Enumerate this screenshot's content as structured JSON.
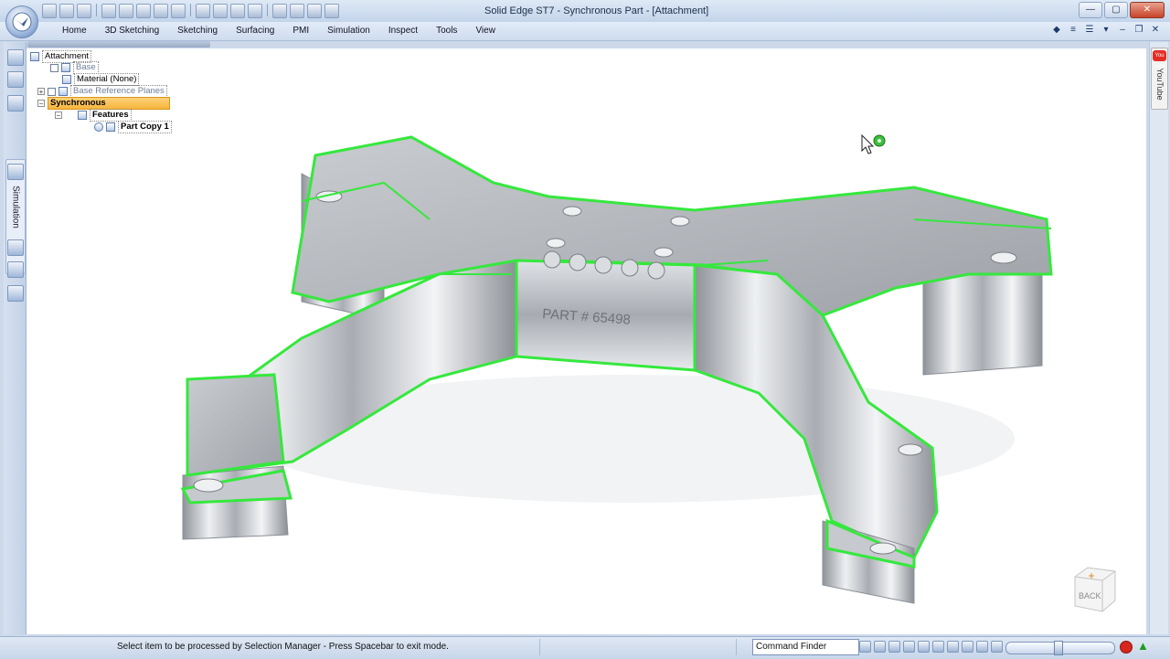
{
  "window": {
    "title": "Solid Edge ST7 - Synchronous Part - [Attachment]",
    "controls": {
      "minimize": "—",
      "maximize": "▢",
      "close": "✕"
    }
  },
  "ribbon": {
    "tabs": [
      "Home",
      "3D Sketching",
      "Sketching",
      "Surfacing",
      "PMI",
      "Simulation",
      "Inspect",
      "Tools",
      "View"
    ]
  },
  "left_bar": {
    "tab_label": "Simulation"
  },
  "right_bar": {
    "youtube_label": "YouTube",
    "youtube_logo": "You Tube"
  },
  "pathfinder": {
    "root": "Attachment",
    "items": [
      {
        "label": "Base"
      },
      {
        "label": "Material (None)"
      },
      {
        "label": "Base Reference Planes",
        "expander": "+"
      },
      {
        "label": "Synchronous",
        "expander": "−"
      },
      {
        "label": "Features",
        "expander": "−"
      },
      {
        "label": "Part Copy 1"
      }
    ]
  },
  "model": {
    "engraving": "PART # 65498",
    "highlight_color": "#35e83d"
  },
  "viewcube": {
    "label": "BACK"
  },
  "status": {
    "prompt": "Select item to be processed by Selection Manager -  Press Spacebar to exit mode.",
    "command_finder": "Command Finder"
  }
}
